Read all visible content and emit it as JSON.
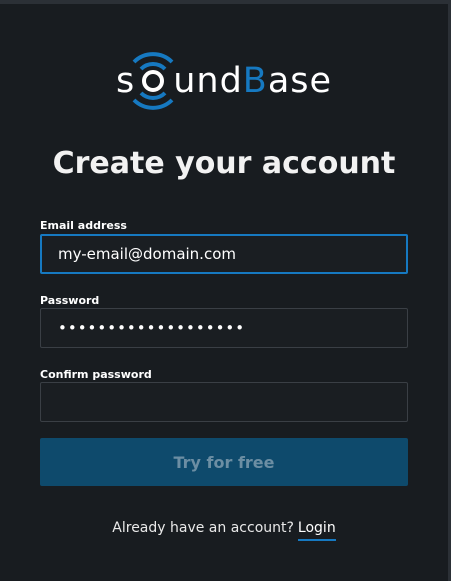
{
  "brand": {
    "part1": "s",
    "part2": "und",
    "part3": "B",
    "part4": "ase",
    "accent_color": "#1679c1"
  },
  "page": {
    "title": "Create your account"
  },
  "form": {
    "email": {
      "label": "Email address",
      "value": "my-email@domain.com"
    },
    "password": {
      "label": "Password",
      "value": "•••••••••••••••••••"
    },
    "confirm_password": {
      "label": "Confirm password",
      "value": ""
    },
    "submit_label": "Try for free"
  },
  "footer": {
    "prompt": "Already have an account?",
    "login_link": "Login"
  }
}
